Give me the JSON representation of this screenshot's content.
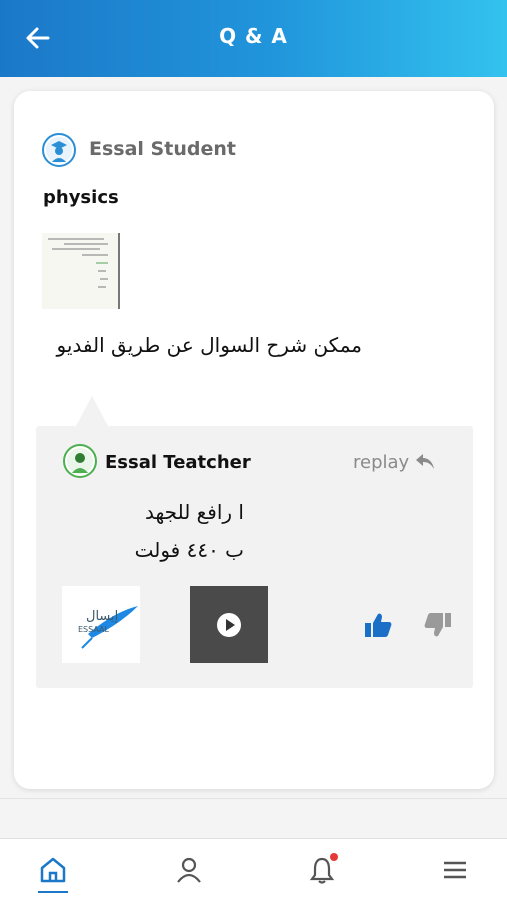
{
  "header": {
    "title": "Q & A"
  },
  "question": {
    "author": "Essal Student",
    "subject": "physics",
    "text": "ممكن شرح السوال عن طريق الفديو"
  },
  "answer": {
    "author": "Essal Teatcher",
    "replay_label": "replay",
    "lines": [
      "ا رافع للجهد",
      "ب ٤٤٠ فولت"
    ],
    "logo": {
      "arabic": "إيسال",
      "latin": "ESSAAL"
    }
  },
  "colors": {
    "brand_blue": "#1b78c8",
    "like_blue": "#1b6fc7",
    "dislike_gray": "#9a9a9a",
    "teacher_green": "#4caf50",
    "notification_red": "#e53935"
  },
  "nav": {
    "items": [
      "home-icon",
      "user-icon",
      "bell-icon",
      "menu-icon"
    ],
    "active": "home-icon",
    "bell_has_notification": true
  }
}
